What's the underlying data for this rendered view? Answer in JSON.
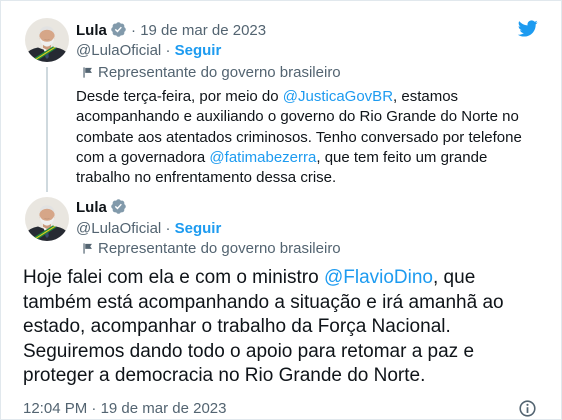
{
  "colors": {
    "text": "#0f1419",
    "secondary": "#536471",
    "link": "#1d9bf0",
    "thread_line": "#cfd9de",
    "verified_badge": "#829aab",
    "brand": "#1d9bf0"
  },
  "icons": {
    "logo": "twitter-bird-icon",
    "verified": "verified-badge-icon",
    "affiliation": "flag-icon",
    "info": "info-icon"
  },
  "separator": "·",
  "thread_tweet": {
    "author_name": "Lula",
    "date": "19 de mar de 2023",
    "handle": "@LulaOficial",
    "follow_label": "Seguir",
    "affiliation": "Representante do governo brasileiro",
    "text_lines": [
      {
        "before": "Desde terça-feira, por meio do ",
        "mention": "@JusticaGovBR",
        "after": ", estamos"
      },
      {
        "text": "acompanhando e auxiliando o governo do Rio Grande do Norte no"
      },
      {
        "text": "combate aos atentados criminosos. Tenho conversado por telefone"
      },
      {
        "before": "com a governadora ",
        "mention": "@fatimabezerra",
        "after": ", que tem feito um grande"
      },
      {
        "text": "trabalho no enfrentamento dessa crise."
      }
    ]
  },
  "main_tweet": {
    "author_name": "Lula",
    "handle": "@LulaOficial",
    "follow_label": "Seguir",
    "affiliation": "Representante do governo brasileiro",
    "text_lines": [
      {
        "before": "Hoje falei com ela e com o ministro ",
        "mention": "@FlavioDino",
        "after": ", que"
      },
      {
        "text": "também está acompanhando a situação e irá amanhã ao"
      },
      {
        "text": "estado, acompanhar o trabalho da Força Nacional."
      },
      {
        "text": "Seguiremos dando todo o apoio para retomar a paz e"
      },
      {
        "text": "proteger a democracia no Rio Grande do Norte."
      }
    ],
    "time": "12:04 PM",
    "date": "19 de mar de 2023"
  }
}
